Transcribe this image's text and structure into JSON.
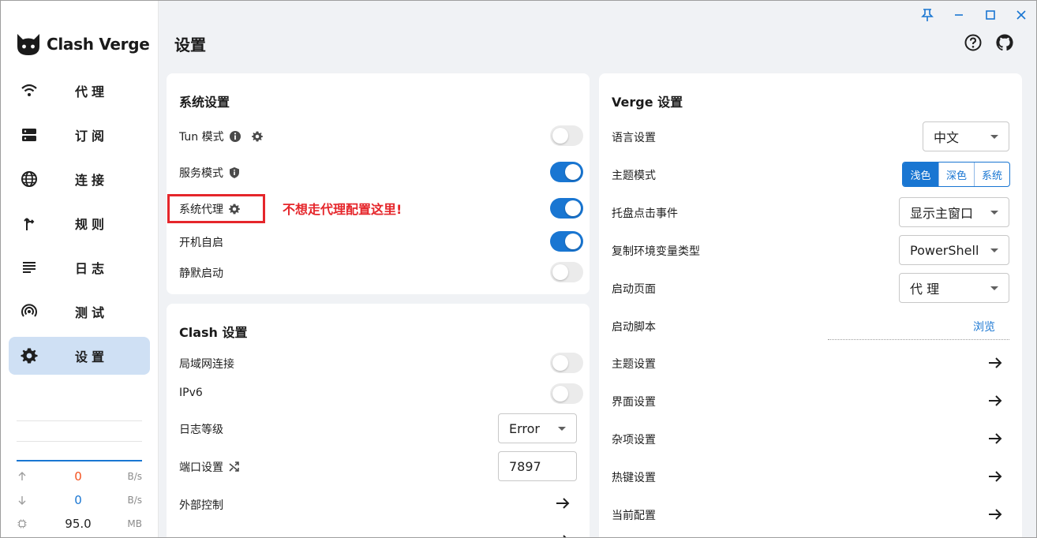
{
  "app": {
    "name": "Clash Verge",
    "page_title": "设置"
  },
  "sidebar": {
    "items": [
      {
        "label": "代理",
        "icon": "wifi-icon",
        "active": false
      },
      {
        "label": "订阅",
        "icon": "server-icon",
        "active": false
      },
      {
        "label": "连接",
        "icon": "globe-icon",
        "active": false
      },
      {
        "label": "规则",
        "icon": "fork-arrow-icon",
        "active": false
      },
      {
        "label": "日志",
        "icon": "list-lines-icon",
        "active": false
      },
      {
        "label": "测试",
        "icon": "signal-icon",
        "active": false
      },
      {
        "label": "设置",
        "icon": "gear-icon",
        "active": true
      }
    ],
    "traffic": {
      "upload": {
        "value": "0",
        "unit": "B/s",
        "color": "#f4511e"
      },
      "download": {
        "value": "0",
        "unit": "B/s",
        "color": "#1976d2"
      },
      "memory": {
        "value": "95.0",
        "unit": "MB"
      }
    }
  },
  "system_settings": {
    "title": "系统设置",
    "tun_mode": {
      "label": "Tun 模式",
      "enabled": false
    },
    "service_mode": {
      "label": "服务模式",
      "enabled": true
    },
    "system_proxy": {
      "label": "系统代理",
      "enabled": true
    },
    "auto_launch": {
      "label": "开机自启",
      "enabled": true
    },
    "silent_start": {
      "label": "静默启动",
      "enabled": false
    }
  },
  "annotation": {
    "text": "不想走代理配置这里!",
    "color": "#e5262b"
  },
  "clash_settings": {
    "title": "Clash 设置",
    "lan": {
      "label": "局域网连接",
      "enabled": false
    },
    "ipv6": {
      "label": "IPv6",
      "enabled": false
    },
    "log_level": {
      "label": "日志等级",
      "value": "Error"
    },
    "port": {
      "label": "端口设置",
      "value": "7897"
    },
    "external_control": {
      "label": "外部控制"
    }
  },
  "verge_settings": {
    "title": "Verge 设置",
    "language": {
      "label": "语言设置",
      "value": "中文"
    },
    "theme_mode": {
      "label": "主题模式",
      "options": [
        "浅色",
        "深色",
        "系统"
      ],
      "selected": "浅色"
    },
    "tray_click": {
      "label": "托盘点击事件",
      "value": "显示主窗口"
    },
    "env_type": {
      "label": "复制环境变量类型",
      "value": "PowerShell"
    },
    "start_page": {
      "label": "启动页面",
      "value": "代 理"
    },
    "start_script": {
      "label": "启动脚本",
      "action": "浏览"
    },
    "theme_settings": {
      "label": "主题设置"
    },
    "ui_settings": {
      "label": "界面设置"
    },
    "misc_settings": {
      "label": "杂项设置"
    },
    "hotkey_settings": {
      "label": "热键设置"
    },
    "current_config": {
      "label": "当前配置"
    }
  },
  "colors": {
    "accent": "#1976d2",
    "sidebar_active": "#cfe0f4",
    "background": "#f0f2f5"
  }
}
